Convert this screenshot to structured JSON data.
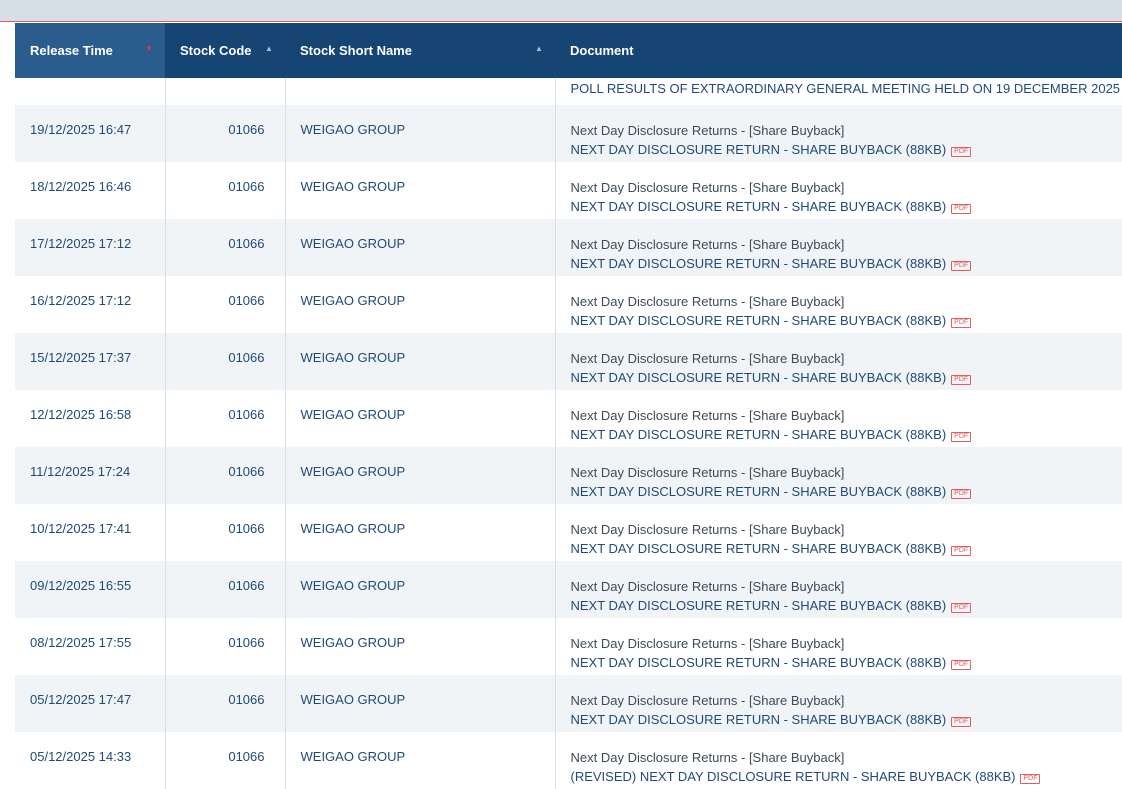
{
  "table": {
    "headers": {
      "release_time": "Release Time",
      "stock_code": "Stock Code",
      "stock_short_name": "Stock Short Name",
      "document": "Document"
    },
    "sort": {
      "release_time": "descending",
      "stock_code": "ascending",
      "stock_short_name": "ascending"
    },
    "partial_row": {
      "doc_link": "POLL RESULTS OF EXTRAORDINARY GENERAL MEETING HELD ON 19 DECEMBER 2025"
    },
    "rows": [
      {
        "time": "19/12/2025 16:47",
        "code": "01066",
        "name": "WEIGAO GROUP",
        "doc_category": "Next Day Disclosure Returns - [Share Buyback]",
        "doc_link": "NEXT DAY DISCLOSURE RETURN - SHARE BUYBACK (88KB)"
      },
      {
        "time": "18/12/2025 16:46",
        "code": "01066",
        "name": "WEIGAO GROUP",
        "doc_category": "Next Day Disclosure Returns - [Share Buyback]",
        "doc_link": "NEXT DAY DISCLOSURE RETURN - SHARE BUYBACK (88KB)"
      },
      {
        "time": "17/12/2025 17:12",
        "code": "01066",
        "name": "WEIGAO GROUP",
        "doc_category": "Next Day Disclosure Returns - [Share Buyback]",
        "doc_link": "NEXT DAY DISCLOSURE RETURN - SHARE BUYBACK (88KB)"
      },
      {
        "time": "16/12/2025 17:12",
        "code": "01066",
        "name": "WEIGAO GROUP",
        "doc_category": "Next Day Disclosure Returns - [Share Buyback]",
        "doc_link": "NEXT DAY DISCLOSURE RETURN - SHARE BUYBACK (88KB)"
      },
      {
        "time": "15/12/2025 17:37",
        "code": "01066",
        "name": "WEIGAO GROUP",
        "doc_category": "Next Day Disclosure Returns - [Share Buyback]",
        "doc_link": "NEXT DAY DISCLOSURE RETURN - SHARE BUYBACK (88KB)"
      },
      {
        "time": "12/12/2025 16:58",
        "code": "01066",
        "name": "WEIGAO GROUP",
        "doc_category": "Next Day Disclosure Returns - [Share Buyback]",
        "doc_link": "NEXT DAY DISCLOSURE RETURN - SHARE BUYBACK (88KB)"
      },
      {
        "time": "11/12/2025 17:24",
        "code": "01066",
        "name": "WEIGAO GROUP",
        "doc_category": "Next Day Disclosure Returns - [Share Buyback]",
        "doc_link": "NEXT DAY DISCLOSURE RETURN - SHARE BUYBACK (88KB)"
      },
      {
        "time": "10/12/2025 17:41",
        "code": "01066",
        "name": "WEIGAO GROUP",
        "doc_category": "Next Day Disclosure Returns - [Share Buyback]",
        "doc_link": "NEXT DAY DISCLOSURE RETURN - SHARE BUYBACK (88KB)"
      },
      {
        "time": "09/12/2025 16:55",
        "code": "01066",
        "name": "WEIGAO GROUP",
        "doc_category": "Next Day Disclosure Returns - [Share Buyback]",
        "doc_link": "NEXT DAY DISCLOSURE RETURN - SHARE BUYBACK (88KB)"
      },
      {
        "time": "08/12/2025 17:55",
        "code": "01066",
        "name": "WEIGAO GROUP",
        "doc_category": "Next Day Disclosure Returns - [Share Buyback]",
        "doc_link": "NEXT DAY DISCLOSURE RETURN - SHARE BUYBACK (88KB)"
      },
      {
        "time": "05/12/2025 17:47",
        "code": "01066",
        "name": "WEIGAO GROUP",
        "doc_category": "Next Day Disclosure Returns - [Share Buyback]",
        "doc_link": "NEXT DAY DISCLOSURE RETURN - SHARE BUYBACK (88KB)"
      },
      {
        "time": "05/12/2025 14:33",
        "code": "01066",
        "name": "WEIGAO GROUP",
        "doc_category": "Next Day Disclosure Returns - [Share Buyback]",
        "doc_link": "(REVISED) NEXT DAY DISCLOSURE RETURN - SHARE BUYBACK (88KB)"
      }
    ],
    "pdf_icon_label": "PDF"
  },
  "colors": {
    "header_bg": "#164573",
    "header_active_bg": "#2a5c8e",
    "link": "#1f4a78",
    "category_text": "#3d4a57",
    "sort_active_arrow": "#e4373e",
    "pdf_icon": "#e25d5d",
    "stripe": "#f1f4f7"
  }
}
